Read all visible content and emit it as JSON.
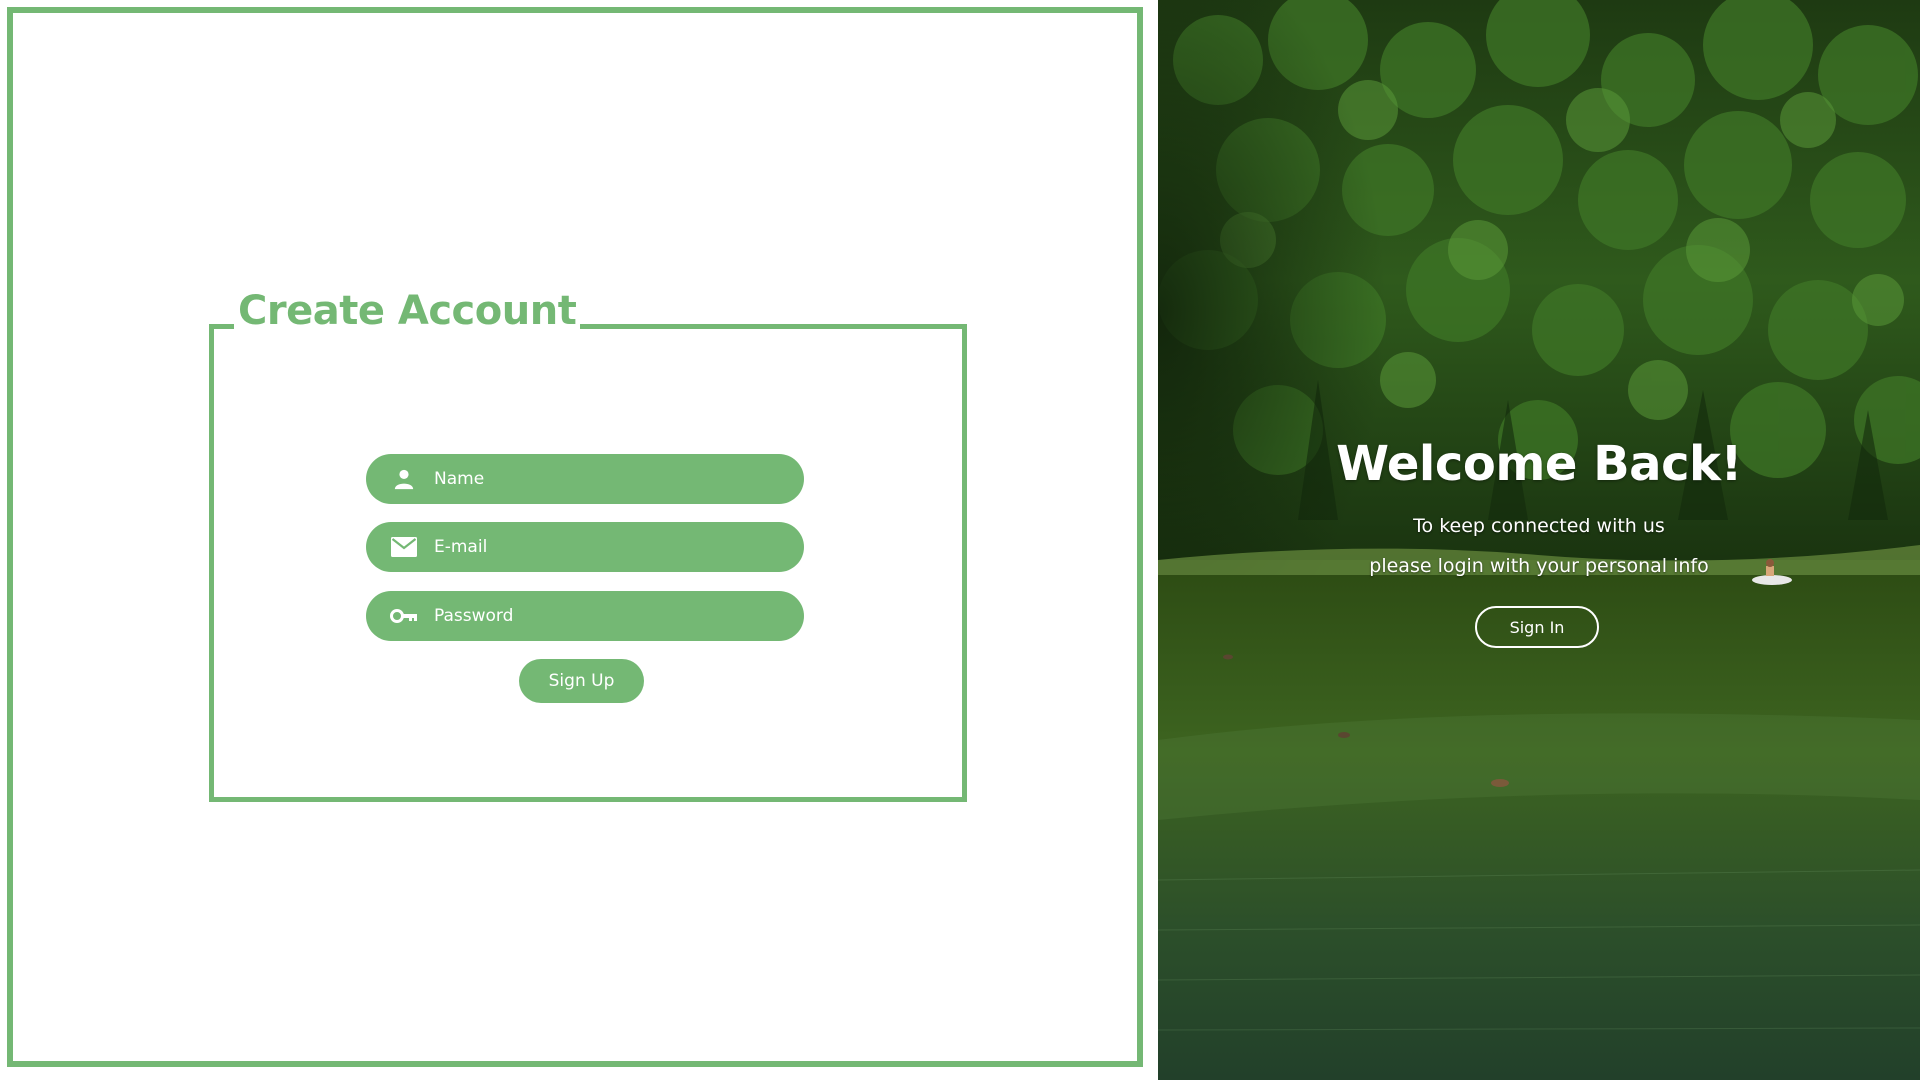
{
  "signup": {
    "title": "Create Account",
    "fields": {
      "name": {
        "placeholder": "Name",
        "icon": "user-icon"
      },
      "email": {
        "placeholder": "E-mail",
        "icon": "mail-icon"
      },
      "password": {
        "placeholder": "Password",
        "icon": "key-icon"
      }
    },
    "button_label": "Sign Up"
  },
  "welcome": {
    "title": "Welcome Back!",
    "line1": "To keep connected with us",
    "line2": "please login with your personal info",
    "button_label": "Sign In"
  },
  "colors": {
    "accent": "#74b874",
    "background": "#ffffff",
    "text_on_accent": "#ffffff"
  }
}
